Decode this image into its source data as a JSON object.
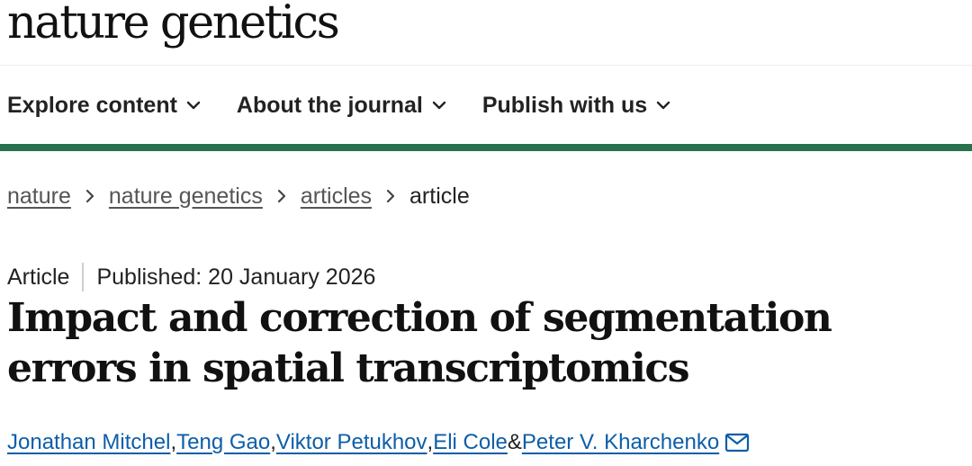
{
  "site": {
    "logo": "nature genetics"
  },
  "nav": {
    "items": [
      {
        "label": "Explore content"
      },
      {
        "label": "About the journal"
      },
      {
        "label": "Publish with us"
      }
    ]
  },
  "breadcrumb": {
    "items": [
      {
        "label": "nature"
      },
      {
        "label": "nature genetics"
      },
      {
        "label": "articles"
      }
    ],
    "current": "article"
  },
  "article": {
    "type": "Article",
    "published": "Published: 20 January 2026",
    "title": "Impact and correction of segmentation errors in spatial transcriptomics",
    "authors": [
      {
        "name": "Jonathan Mitchel",
        "sep": ", "
      },
      {
        "name": "Teng Gao",
        "sep": ", "
      },
      {
        "name": "Viktor Petukhov",
        "sep": ", "
      },
      {
        "name": "Eli Cole",
        "sep": " & "
      },
      {
        "name": "Peter V. Kharchenko",
        "sep": ""
      }
    ]
  },
  "colors": {
    "accent_bar": "#29714f",
    "author_link": "#0d5ea8"
  },
  "icons": [
    "chevron-down-icon",
    "chevron-right-icon",
    "mail-icon"
  ]
}
